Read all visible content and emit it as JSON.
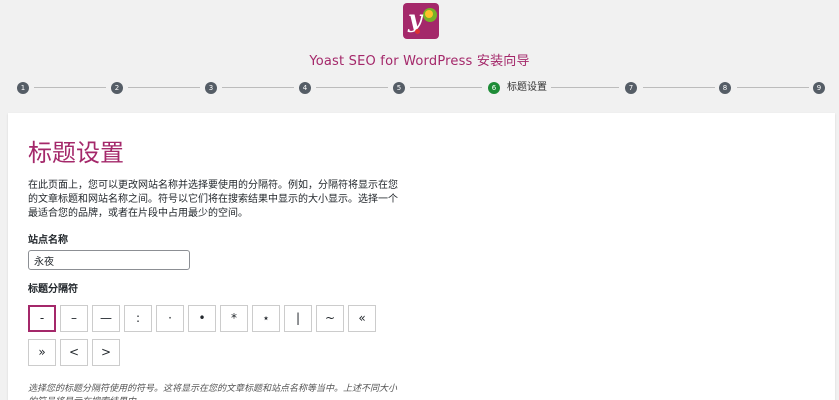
{
  "header": {
    "logo_letter": "y",
    "title": "Yoast SEO for WordPress 安装向导"
  },
  "stepper": {
    "steps": [
      "1",
      "2",
      "3",
      "4",
      "5",
      "6",
      "7",
      "8",
      "9"
    ],
    "active_step": "6",
    "active_label": "标题设置"
  },
  "main": {
    "page_title": "标题设置",
    "intro": "在此页面上，您可以更改网站名称并选择要使用的分隔符。例如，分隔符将显示在您的文章标题和网站名称之间。符号以它们将在搜索结果中显示的大小显示。选择一个最适合您的品牌，或者在片段中占用最少的空间。",
    "site_name_label": "站点名称",
    "site_name_value": "永夜",
    "separator_label": "标题分隔符",
    "separators": [
      "-",
      "–",
      "—",
      ":",
      "·",
      "•",
      "*",
      "⋆",
      "|",
      "~",
      "«",
      "»",
      "<",
      ">"
    ],
    "selected_separator": "-",
    "hint": "选择您的标题分隔符使用的符号。这将显示在您的文章标题和站点名称等当中。上述不同大小的符号将显示在搜索结果中。"
  },
  "colors": {
    "brand": "#a4286a",
    "active_step": "#1e8c37",
    "step": "#555d66"
  }
}
